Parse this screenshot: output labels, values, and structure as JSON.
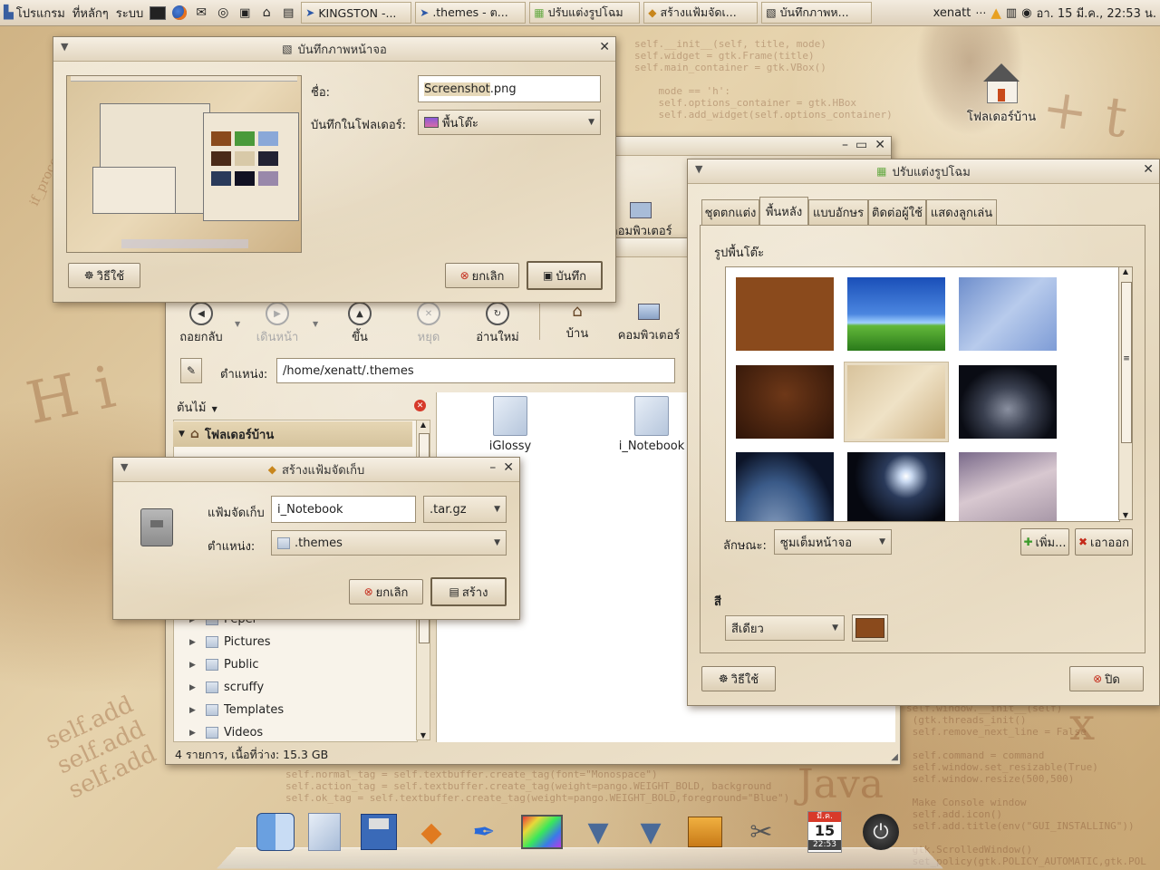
{
  "panel": {
    "menu_apps": "โปรแกรม",
    "menu_places": "ที่หลักๆ",
    "menu_system": "ระบบ",
    "tasks": [
      {
        "label": "KINGSTON -..."
      },
      {
        "label": ".themes - ต..."
      },
      {
        "label": "ปรับแต่งรูปโฉม"
      },
      {
        "label": "สร้างแฟ้มจัดเ..."
      },
      {
        "label": "บันทึกภาพห..."
      }
    ],
    "user": "xenatt",
    "clock": "อา. 15 มี.ค., 22:53 น."
  },
  "desktop": {
    "home_folder_label": "โฟลเดอร์บ้าน"
  },
  "screenshot_dialog": {
    "title": "บันทึกภาพหน้าจอ",
    "name_label": "ชื่อ:",
    "name_value_selected": "Screenshot",
    "name_value_ext": ".png",
    "folder_label": "บันทึกในโฟลเดอร์:",
    "folder_value": "พื้นโต๊ะ",
    "help_label": "วิธีใช้",
    "cancel_label": "ยกเลิก",
    "save_label": "บันทึก"
  },
  "file_manager": {
    "toolbar": {
      "back": "ถอยกลับ",
      "forward": "เดินหน้า",
      "up": "ขึ้น",
      "stop": "หยุด",
      "reload": "อ่านใหม่",
      "home": "บ้าน",
      "computer": "คอมพิวเตอร์"
    },
    "location_label": "ตำแหน่ง:",
    "location_value": "/home/xenatt/.themes",
    "sidebar_mode": "ต้นไม้",
    "home_folder": "โฟลเดอร์บ้าน",
    "tree": [
      "Peper",
      "Pictures",
      "Public",
      "scruffy",
      "Templates",
      "Videos"
    ],
    "files": [
      "iGlossy",
      "i_Notebook"
    ],
    "status": "4 รายการ, เนื้อที่ว่าง: 15.3 GB",
    "bg_window_computer": "คอมพิวเตอร์"
  },
  "archive_dialog": {
    "title": "สร้างแฟ้มจัดเก็บ",
    "archive_label": "แฟ้มจัดเก็บ",
    "archive_value": "i_Notebook",
    "ext_value": ".tar.gz",
    "location_label": "ตำแหน่ง:",
    "location_value": ".themes",
    "cancel_label": "ยกเลิก",
    "create_label": "สร้าง"
  },
  "appearance": {
    "title": "ปรับแต่งรูปโฉม",
    "tabs": [
      "ชุดตกแต่ง",
      "พื้นหลัง",
      "แบบอักษร",
      "ติดต่อผู้ใช้",
      "แสดงลูกเล่น"
    ],
    "active_tab": 1,
    "section_wallpaper": "รูปพื้นโต๊ะ",
    "style_label": "ลักษณะ:",
    "style_value": "ซูมเต็มหน้าจอ",
    "add_label": "เพิ่ม...",
    "remove_label": "เอาออก",
    "section_color": "สี",
    "color_mode": "สีเดียว",
    "color_value": "#8a4a1c",
    "help_label": "วิธีใช้",
    "close_label": "ปิด",
    "thumbnails": [
      "brown-solid",
      "green-hills",
      "blue-light-streaks",
      "dark-brown-texture",
      "parchment-face",
      "space-station",
      "earth-from-orbit",
      "space-sunburst",
      "spacecraft-clouds"
    ],
    "selected_thumbnail": 4
  },
  "dock": {
    "calendar_month": "มี.ค.",
    "calendar_day": "15",
    "calendar_time": "22:53"
  },
  "colors": {
    "panel_bg": "#e8dcc6",
    "window_bg": "#efe6d4",
    "accent_brown": "#8a4a1c"
  }
}
